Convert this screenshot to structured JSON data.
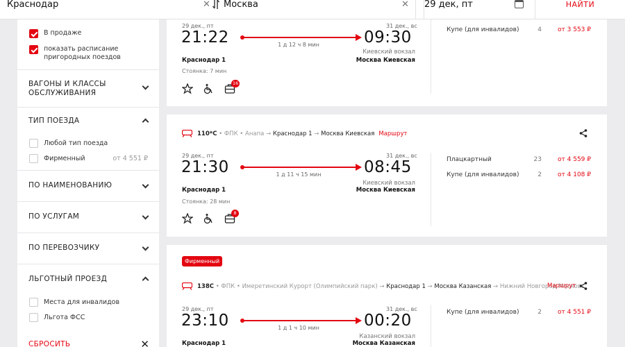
{
  "search": {
    "from": "Краснодар",
    "to": "Москва",
    "date": "29 дек, пт",
    "find_label": "НАЙТИ"
  },
  "filters": {
    "top_checks": [
      {
        "label": "В продаже",
        "checked": true
      },
      {
        "label": "показать расписание пригородных поездов",
        "checked": true
      }
    ],
    "sections": {
      "wagons": "ВАГОНЫ И КЛАССЫ ОБСЛУЖИВАНИЯ",
      "train_type": "ТИП ПОЕЗДА",
      "by_name": "ПО НАИМЕНОВАНИЮ",
      "services": "ПО УСЛУГАМ",
      "carrier": "ПО ПЕРЕВОЗЧИКУ",
      "benefit": "ЛЬГОТНЫЙ ПРОЕЗД"
    },
    "train_type_opts": [
      {
        "label": "Любой тип поезда",
        "price": ""
      },
      {
        "label": "Фирменный",
        "price": "от 4 551 ₽"
      }
    ],
    "benefit_opts": [
      {
        "label": "Места для инвалидов"
      },
      {
        "label": "Льгота ФСС"
      }
    ],
    "reset_label": "СБРОСИТЬ"
  },
  "trains": [
    {
      "dep_date": "29 дек., пт",
      "dep_time": "21:22",
      "duration": "1 д 12 ч 8 мин",
      "arr_date": "31 дек., вс",
      "arr_time": "09:30",
      "dep_station": "Краснодар 1",
      "arr_vokzal": "Киевский вокзал",
      "arr_station": "Москва Киевская",
      "stop": "Стоянка: 7 мин",
      "badge": "16",
      "classes": [
        {
          "name": "Купе (для инвалидов)",
          "count": "4",
          "price": "от 3 553 ₽"
        }
      ]
    },
    {
      "number": "110*С",
      "carrier": "• ФПК •",
      "route_from": "Анапа",
      "route_a": "Краснодар 1",
      "route_b": "Москва Киевская",
      "route_link": "Маршрут",
      "dep_date": "29 дек., пт",
      "dep_time": "21:30",
      "duration": "1 д 11 ч 15 мин",
      "arr_date": "31 дек., вс",
      "arr_time": "08:45",
      "dep_station": "Краснодар 1",
      "arr_vokzal": "Киевский вокзал",
      "arr_station": "Москва Киевская",
      "stop": "Стоянка: 28 мин",
      "badge": "8",
      "classes": [
        {
          "name": "Плацкартный",
          "count": "23",
          "price": "от 4 559 ₽"
        },
        {
          "name": "Купе (для инвалидов)",
          "count": "2",
          "price": "от 4 108 ₽"
        }
      ]
    },
    {
      "firm": "Фирменный",
      "number": "138С",
      "carrier": "• ФПК •",
      "route_from": "Имеретинский Курорт (Олимпийский парк)",
      "route_a": "Краснодар 1",
      "route_b": "Москва Казанская",
      "route_c": "Нижний Новгород Московс",
      "route_link": "Маршрут",
      "dep_date": "29 дек., пт",
      "dep_time": "23:10",
      "duration": "1 д 1 ч 10 мин",
      "arr_date": "31 дек., вс",
      "arr_time": "00:20",
      "dep_station": "Краснодар 1",
      "arr_vokzal": "Казанский вокзал",
      "arr_station": "Москва Казанская",
      "classes": [
        {
          "name": "Купе (для инвалидов)",
          "count": "2",
          "price": "от 4 551 ₽"
        }
      ]
    }
  ]
}
